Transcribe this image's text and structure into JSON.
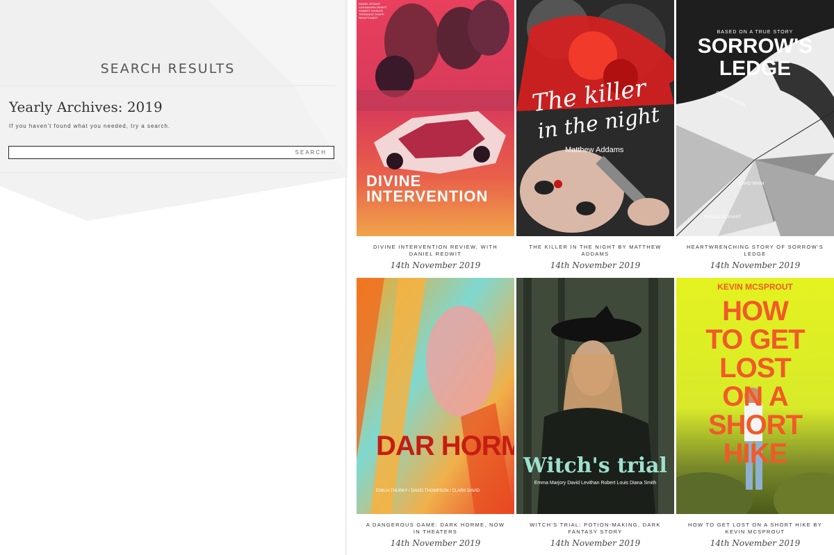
{
  "sidebar": {
    "heading": "SEARCH RESULTS",
    "archive_title": "Yearly Archives: 2019",
    "hint": "If you haven't found what you needed, try a search.",
    "search": {
      "value": "",
      "button_label": "SEARCH"
    }
  },
  "posts": [
    {
      "title": "DIVINE INTERVENTION REVIEW, WITH DANIEL REDWIT",
      "date": "14th November 2019",
      "poster": {
        "headline_1": "DIVINE",
        "headline_2": "INTERVENTION",
        "cast": [
          "DANIEL REDWIT",
          "CASSANDRA DEWITT",
          "ROBERT CHISLEN",
          "TERRANCE SHAPE",
          "NAYA FOLMOT"
        ]
      }
    },
    {
      "title": "THE KILLER IN THE NIGHT BY MATTHEW ADDAMS",
      "date": "14th November 2019",
      "poster": {
        "headline_1": "The killer",
        "headline_2": "in the night",
        "author": "Matthew Addams"
      }
    },
    {
      "title": "HEARTWRENCHING STORY OF SORROW'S LEDGE",
      "date": "14th November 2019",
      "poster": {
        "tagline": "BASED ON A TRUE STORY",
        "headline_1": "SORROW'S",
        "headline_2": "LEDGE",
        "names": [
          "COLIN LEVITON",
          "DAVID WHIM",
          "EMILIA LOCKHART"
        ]
      }
    },
    {
      "title": "A DANGEROUS GAME: DARK HORME, NOW IN THEATERS",
      "date": "14th November 2019",
      "poster": {
        "headline_1": "DAR HORME",
        "credits": "EMILIA THURKY / DAVID THOMPSON / CLARK DAVID"
      }
    },
    {
      "title": "WITCH'S TRIAL: POTION-MAKING, DARK FANTASY STORY",
      "date": "14th November 2019",
      "poster": {
        "headline_1": "Witch's trial",
        "credits": "Emma Marjory  David Levithan  Robert Louis  Diana Smith"
      }
    },
    {
      "title": "HOW TO GET LOST ON A SHORT HIKE BY KEVIN MCSPROUT",
      "date": "14th November 2019",
      "poster": {
        "author": "KEVIN MCSPROUT",
        "lines": [
          "HOW",
          "TO GET",
          "LOST",
          "ON A",
          "SHORT",
          "HIKE"
        ]
      }
    }
  ]
}
